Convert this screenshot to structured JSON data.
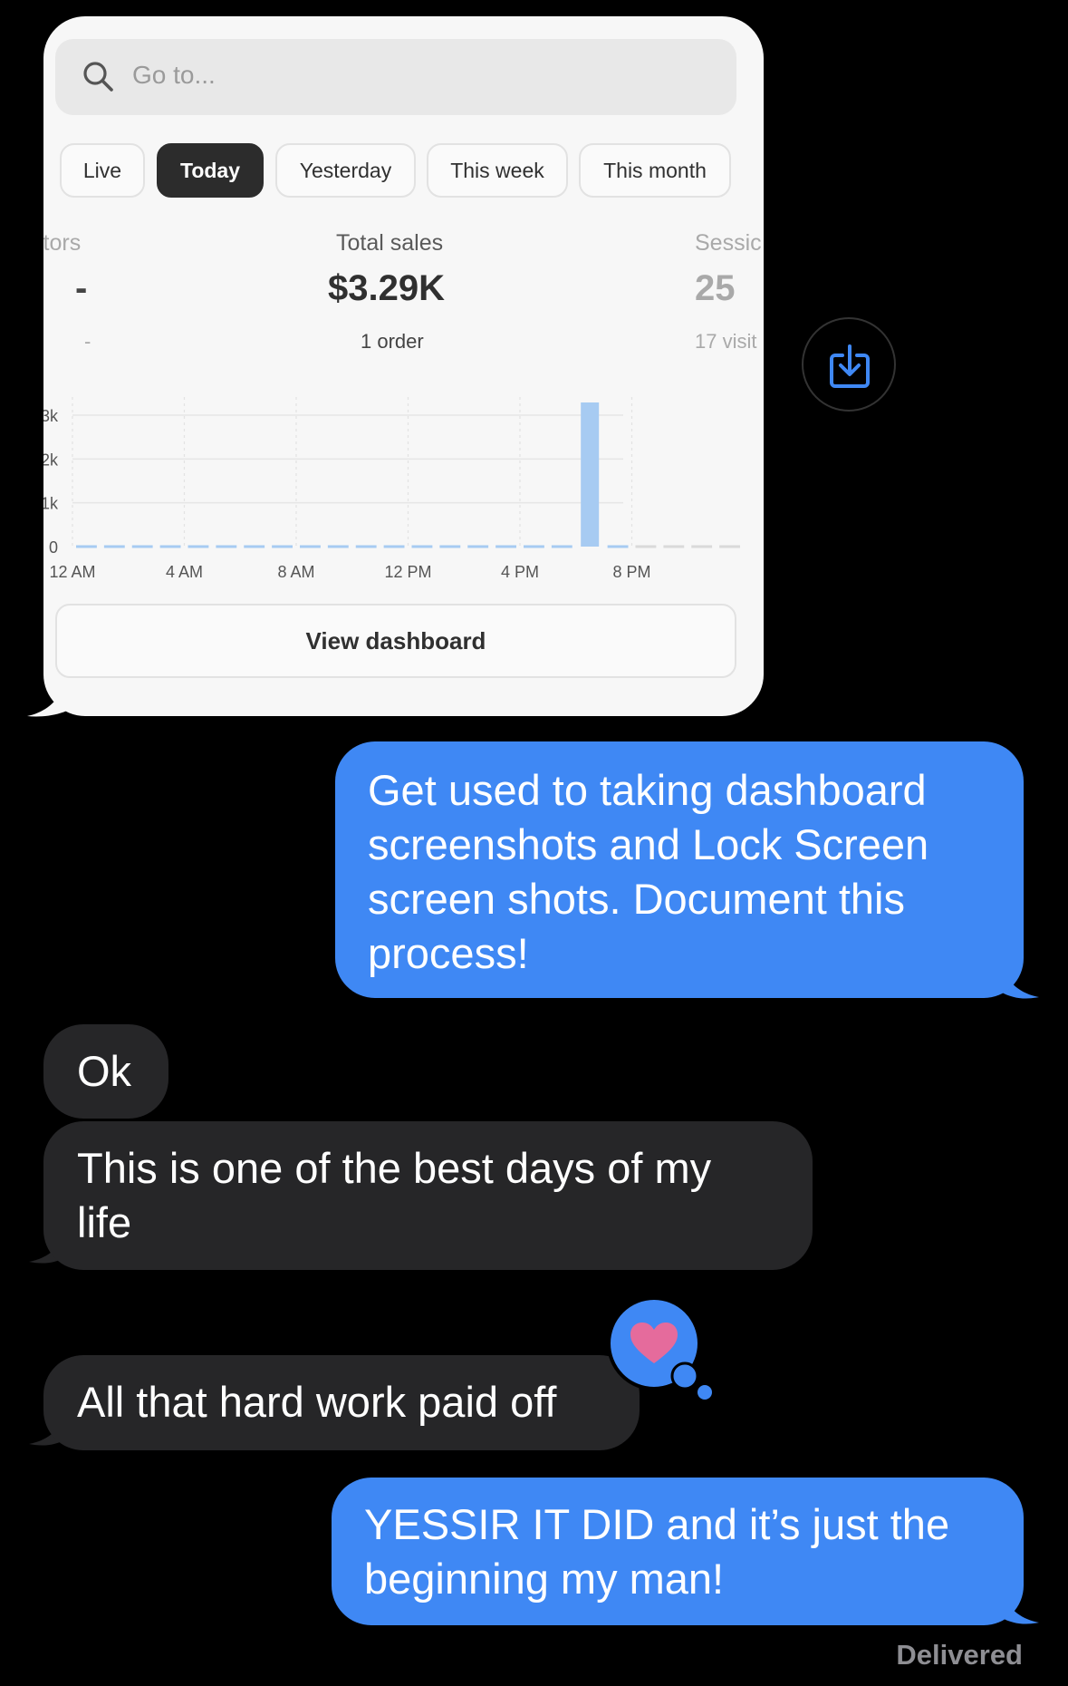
{
  "dashboard": {
    "search_placeholder": "Go to...",
    "tabs": [
      "Live",
      "Today",
      "Yesterday",
      "This week",
      "This month"
    ],
    "active_tab": "Today",
    "metrics": [
      {
        "label": "itors",
        "value": "-",
        "sub": "-"
      },
      {
        "label": "Total sales",
        "value": "$3.29K",
        "sub": "1 order"
      },
      {
        "label": "Sessic",
        "value": "25",
        "sub": "17 visit"
      }
    ],
    "view_button": "View dashboard"
  },
  "chart_data": {
    "type": "bar",
    "title": "",
    "xlabel": "",
    "ylabel": "",
    "x_tick_labels": [
      "12 AM",
      "4 AM",
      "8 AM",
      "12 PM",
      "4 PM",
      "8 PM"
    ],
    "y_tick_labels": [
      "3k",
      "2k",
      "1k",
      "0"
    ],
    "ylim": [
      0,
      3000
    ],
    "categories": [
      "12 AM",
      "1 AM",
      "2 AM",
      "3 AM",
      "4 AM",
      "5 AM",
      "6 AM",
      "7 AM",
      "8 AM",
      "9 AM",
      "10 AM",
      "11 AM",
      "12 PM",
      "1 PM",
      "2 PM",
      "3 PM",
      "4 PM",
      "5 PM",
      "6 PM",
      "7 PM",
      "8 PM",
      "9 PM",
      "10 PM",
      "11 PM"
    ],
    "values": [
      0,
      0,
      0,
      0,
      0,
      0,
      0,
      0,
      0,
      0,
      0,
      0,
      0,
      0,
      0,
      0,
      0,
      0,
      3290,
      0,
      null,
      null,
      null,
      null
    ],
    "bar_color": "#a7cbf2",
    "grid": true
  },
  "messages": [
    {
      "id": "m1",
      "direction": "outgoing",
      "text_lines": [
        "Get used to taking dashboard",
        "screenshots and Lock Screen",
        "screen shots. Document this",
        "process!"
      ]
    },
    {
      "id": "m2",
      "direction": "incoming",
      "text_lines": [
        "Ok"
      ]
    },
    {
      "id": "m3",
      "direction": "incoming",
      "text_lines": [
        "This is one of the best days of my",
        "life"
      ]
    },
    {
      "id": "m4",
      "direction": "incoming",
      "text_lines": [
        "All that hard work paid off"
      ],
      "reaction": "heart"
    },
    {
      "id": "m5",
      "direction": "outgoing",
      "text_lines": [
        "YESSIR IT DID and it’s just the",
        "beginning my man!"
      ]
    }
  ],
  "status": "Delivered",
  "colors": {
    "outgoing_bubble": "#3f88f4",
    "incoming_bubble": "#262628",
    "reaction_heart": "#e56b9c",
    "save_icon": "#3f88f4"
  }
}
